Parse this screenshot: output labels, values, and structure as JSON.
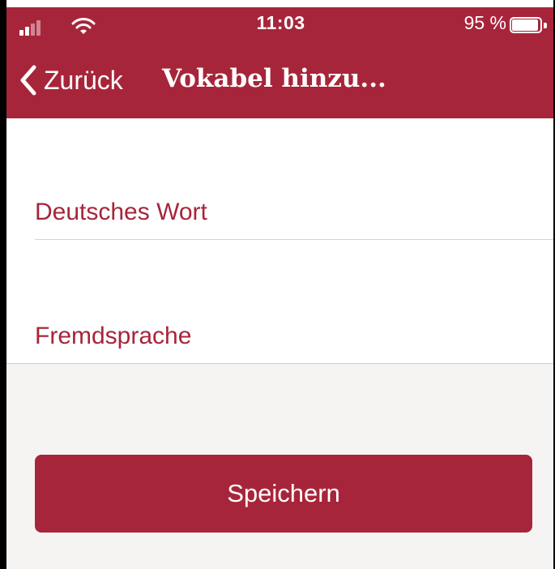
{
  "status_bar": {
    "time": "11:03",
    "battery_percent": "95 %",
    "battery_level": 0.95,
    "signal_bars_active": 2,
    "signal_bars_total": 4
  },
  "navbar": {
    "back_label": "Zurück",
    "title": "Vokabel hinzu..."
  },
  "form": {
    "german_word": {
      "placeholder": "Deutsches Wort",
      "value": ""
    },
    "foreign_word": {
      "placeholder": "Fremdsprache",
      "value": ""
    }
  },
  "actions": {
    "save_label": "Speichern"
  },
  "icons": {
    "back": "chevron-left-icon",
    "signal": "cellular-signal-icon",
    "wifi": "wifi-icon",
    "battery": "battery-icon"
  },
  "colors": {
    "accent": "#A7253A",
    "background_lower": "#F6F4F2",
    "background_form": "#FFFFFF",
    "text_on_accent": "#FFFFFF",
    "divider": "#D3D3D3"
  }
}
